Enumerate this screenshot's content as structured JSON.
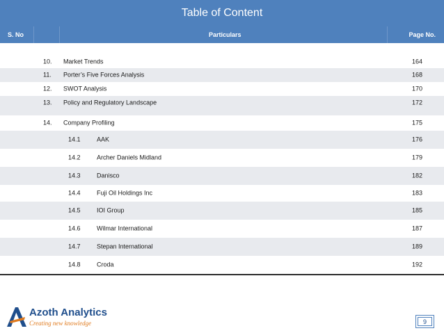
{
  "title": "Table of Content",
  "header": {
    "sno": "S. No",
    "particulars": "Particulars",
    "page_no": "Page No."
  },
  "rows": [
    {
      "num": "10.",
      "label": "Market Trends",
      "page": "164"
    },
    {
      "num": "11.",
      "label": "Porter’s Five Forces Analysis",
      "page": "168"
    },
    {
      "num": "12.",
      "label": "SWOT Analysis",
      "page": "170"
    },
    {
      "num": "13.",
      "label": "Policy and Regulatory Landscape",
      "page": "172"
    },
    {
      "num": "14.",
      "label": "Company Profiling",
      "page": "175"
    }
  ],
  "subrows": [
    {
      "num": "14.1",
      "label": "AAK",
      "page": "176"
    },
    {
      "num": "14.2",
      "label": "Archer Daniels Midland",
      "page": "179"
    },
    {
      "num": "14.3",
      "label": "Danisco",
      "page": "182"
    },
    {
      "num": "14.4",
      "label": "Fuji Oil Holdings Inc",
      "page": "183"
    },
    {
      "num": "14.5",
      "label": "IOI Group",
      "page": "185"
    },
    {
      "num": "14.6",
      "label": "Wilmar International",
      "page": "187"
    },
    {
      "num": "14.7",
      "label": "Stepan International",
      "page": "189"
    },
    {
      "num": "14.8",
      "label": "Croda",
      "page": "192"
    }
  ],
  "logo": {
    "name": "Azoth Analytics",
    "tagline": "Creating new knowledge"
  },
  "page_number": "9",
  "colors": {
    "header": "#4f81bd",
    "shade": "#e8eaee",
    "brand_blue": "#1f4e8c",
    "brand_orange": "#e07b1f"
  }
}
